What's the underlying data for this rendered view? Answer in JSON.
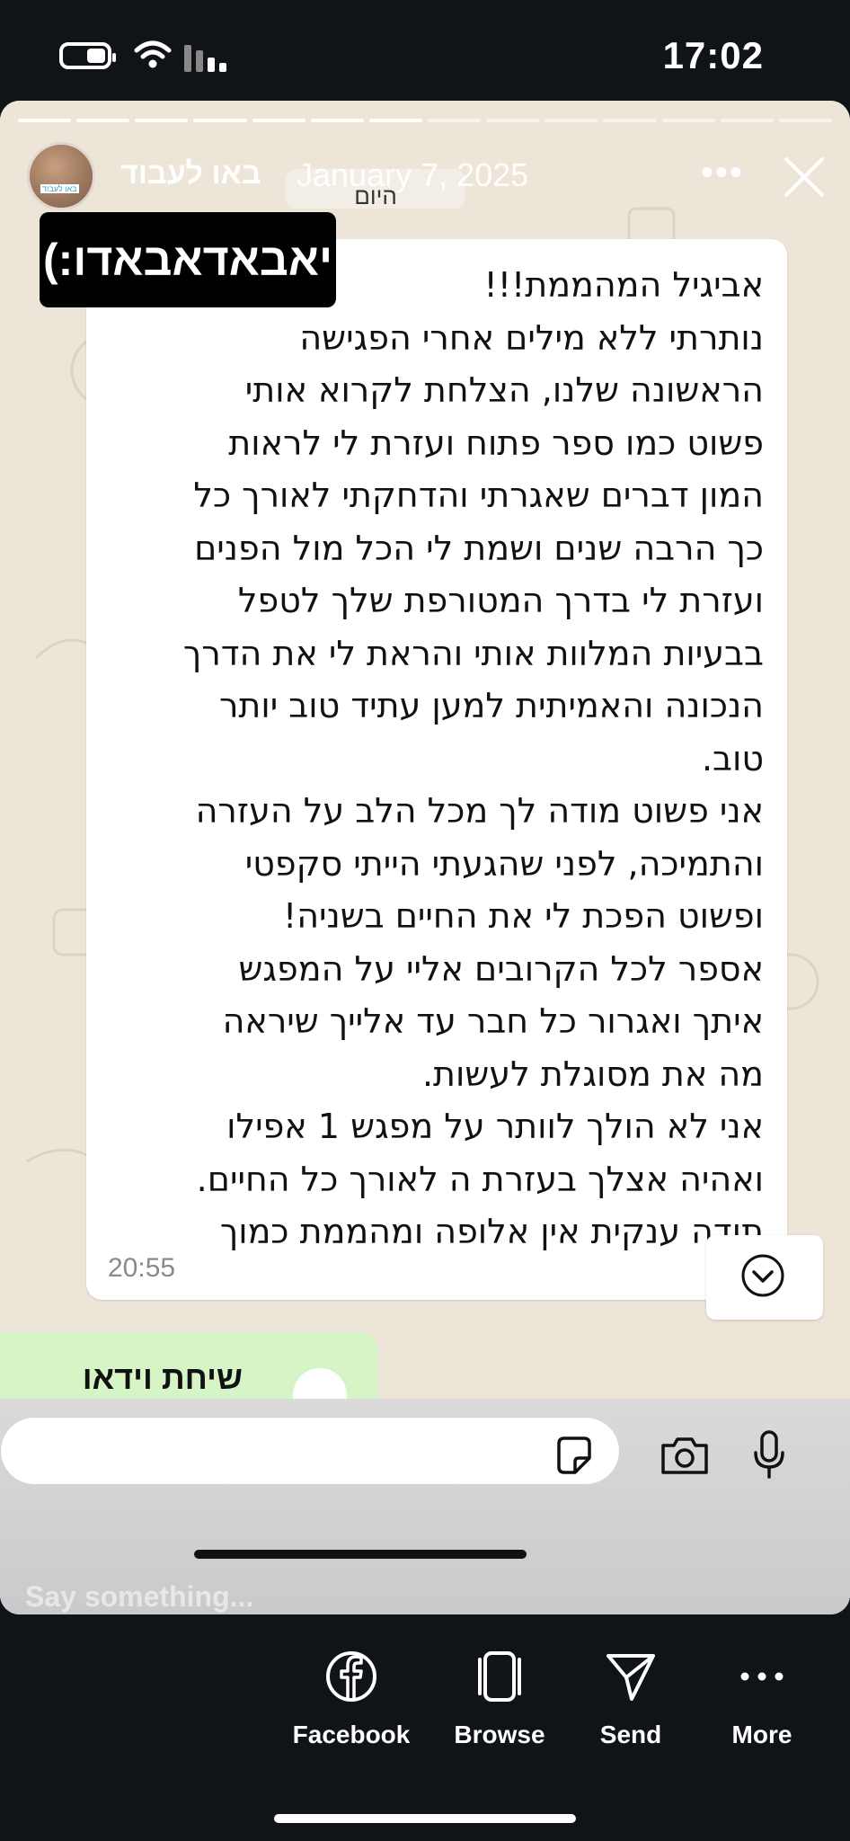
{
  "status_bar": {
    "time": "17:02"
  },
  "story": {
    "username": "באו לעבוד",
    "avatar_label": "באו לעבוד",
    "date": "January 7, 2025",
    "today_label": "היום",
    "sticker_text": "יאבאדאבאדו:)"
  },
  "chat": {
    "message_lines": [
      "אביגיל המהממת!!!",
      "נותרתי ללא מילים אחרי הפגישה",
      "הראשונה שלנו, הצלחת לקרוא אותי",
      "פשוט כמו ספר פתוח ועזרת לי לראות",
      "המון דברים שאגרתי והדחקתי לאורך כל",
      "כך הרבה שנים ושמת לי הכל מול הפנים",
      "ועזרת לי בדרך המטורפת שלך לטפל",
      "בבעיות המלוות אותי והראת לי את הדרך",
      "הנכונה והאמיתית למען עתיד טוב יותר",
      "טוב.",
      "אני פשוט מודה לך מכל הלב על העזרה",
      "והתמיכה, לפני שהגעתי הייתי סקפטי",
      "ופשוט הפכת לי את החיים בשניה!",
      "אספר לכל הקרובים אליי על המפגש",
      "איתך ואגרור כל חבר עד אלייך שיראה",
      "מה את מסוגלת לעשות.",
      "אני לא הולך לוותר על מפגש 1 אפילו",
      "ואהיה אצלך בעזרת ה לאורך כל החיים.",
      "תודה ענקית אין אלופה ומהממת כמוך"
    ],
    "message_time": "20:55",
    "video_call_label": "שיחת וידאו"
  },
  "reply": {
    "placeholder": "Say something..."
  },
  "share": [
    {
      "label": "Facebook",
      "icon": "facebook-icon"
    },
    {
      "label": "Browse",
      "icon": "browse-icon"
    },
    {
      "label": "Send",
      "icon": "send-icon"
    },
    {
      "label": "More",
      "icon": "more-icon"
    }
  ]
}
